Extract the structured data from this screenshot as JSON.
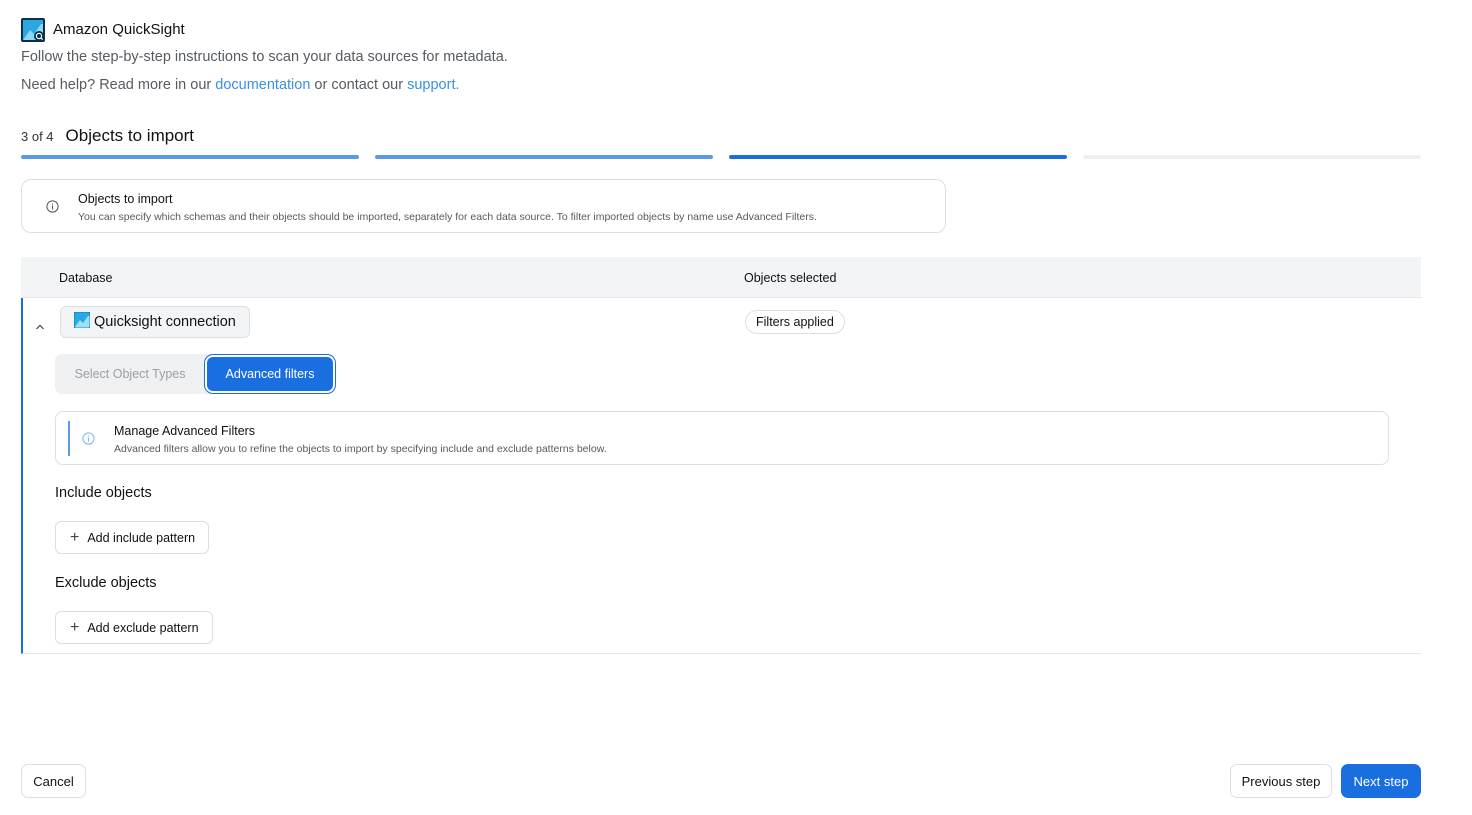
{
  "app": {
    "title": "Amazon QuickSight",
    "subtitle": "Follow the step-by-step instructions to scan your data sources for metadata.",
    "help_prefix": "Need help? Read more in our ",
    "help_doc_link": "documentation",
    "help_middle": " or contact our ",
    "help_support_link": "support."
  },
  "wizard": {
    "step_count": "3 of 4",
    "step_title": "Objects to import",
    "progress": {
      "total_steps": 4,
      "current_step": 3
    }
  },
  "info_card": {
    "icon": "info-icon",
    "title": "Objects to import",
    "description": "You can specify which schemas and their objects should be imported, separately for each data source. To filter imported objects by name use Advanced Filters."
  },
  "table": {
    "columns": [
      "Database",
      "Objects selected"
    ],
    "row": {
      "connection_name": "Quicksight connection",
      "objects_selected": "Filters applied",
      "tabs": [
        {
          "label": "Select Object Types",
          "active": false
        },
        {
          "label": "Advanced filters",
          "active": true
        }
      ],
      "manage_card": {
        "icon": "info-icon",
        "title": "Manage Advanced Filters",
        "description": "Advanced filters allow you to refine the objects to import by specifying include and exclude patterns below."
      },
      "include": {
        "label": "Include objects",
        "button": "Add include pattern"
      },
      "exclude": {
        "label": "Exclude objects",
        "button": "Add exclude pattern"
      }
    }
  },
  "footer": {
    "cancel": "Cancel",
    "previous": "Previous step",
    "next": "Next step"
  },
  "colors": {
    "primary": "#1a6fe0",
    "link": "#3b8fe0",
    "progress_done": "#5b9be6",
    "logo_dark": "#0b2f4a",
    "logo_light": "#2aa8e0"
  }
}
